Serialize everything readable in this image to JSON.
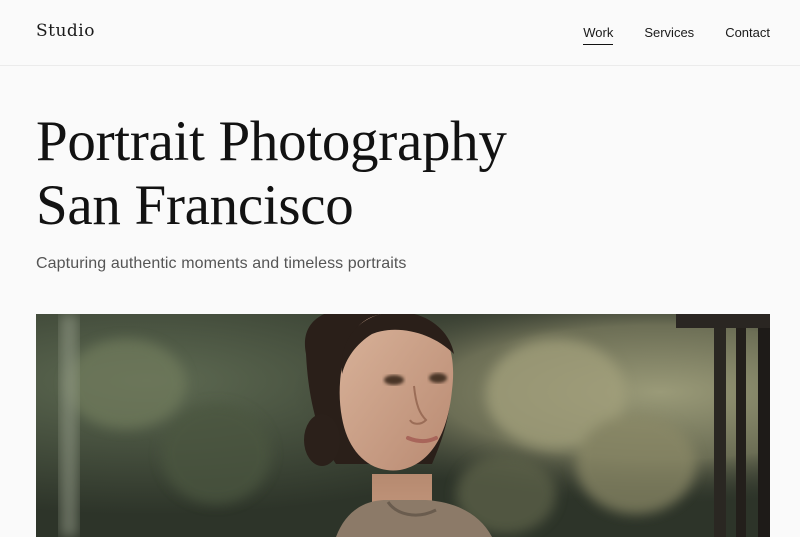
{
  "header": {
    "logo": "Studio",
    "nav": [
      {
        "label": "Work",
        "active": true
      },
      {
        "label": "Services",
        "active": false
      },
      {
        "label": "Contact",
        "active": false
      }
    ]
  },
  "hero": {
    "title_line1": "Portrait Photography",
    "title_line2": "San Francisco",
    "subtitle": "Capturing authentic moments and timeless portraits"
  },
  "colors": {
    "background": "#fafafa",
    "text": "#121212",
    "subtitle": "#555555",
    "divider": "#ebebeb"
  }
}
